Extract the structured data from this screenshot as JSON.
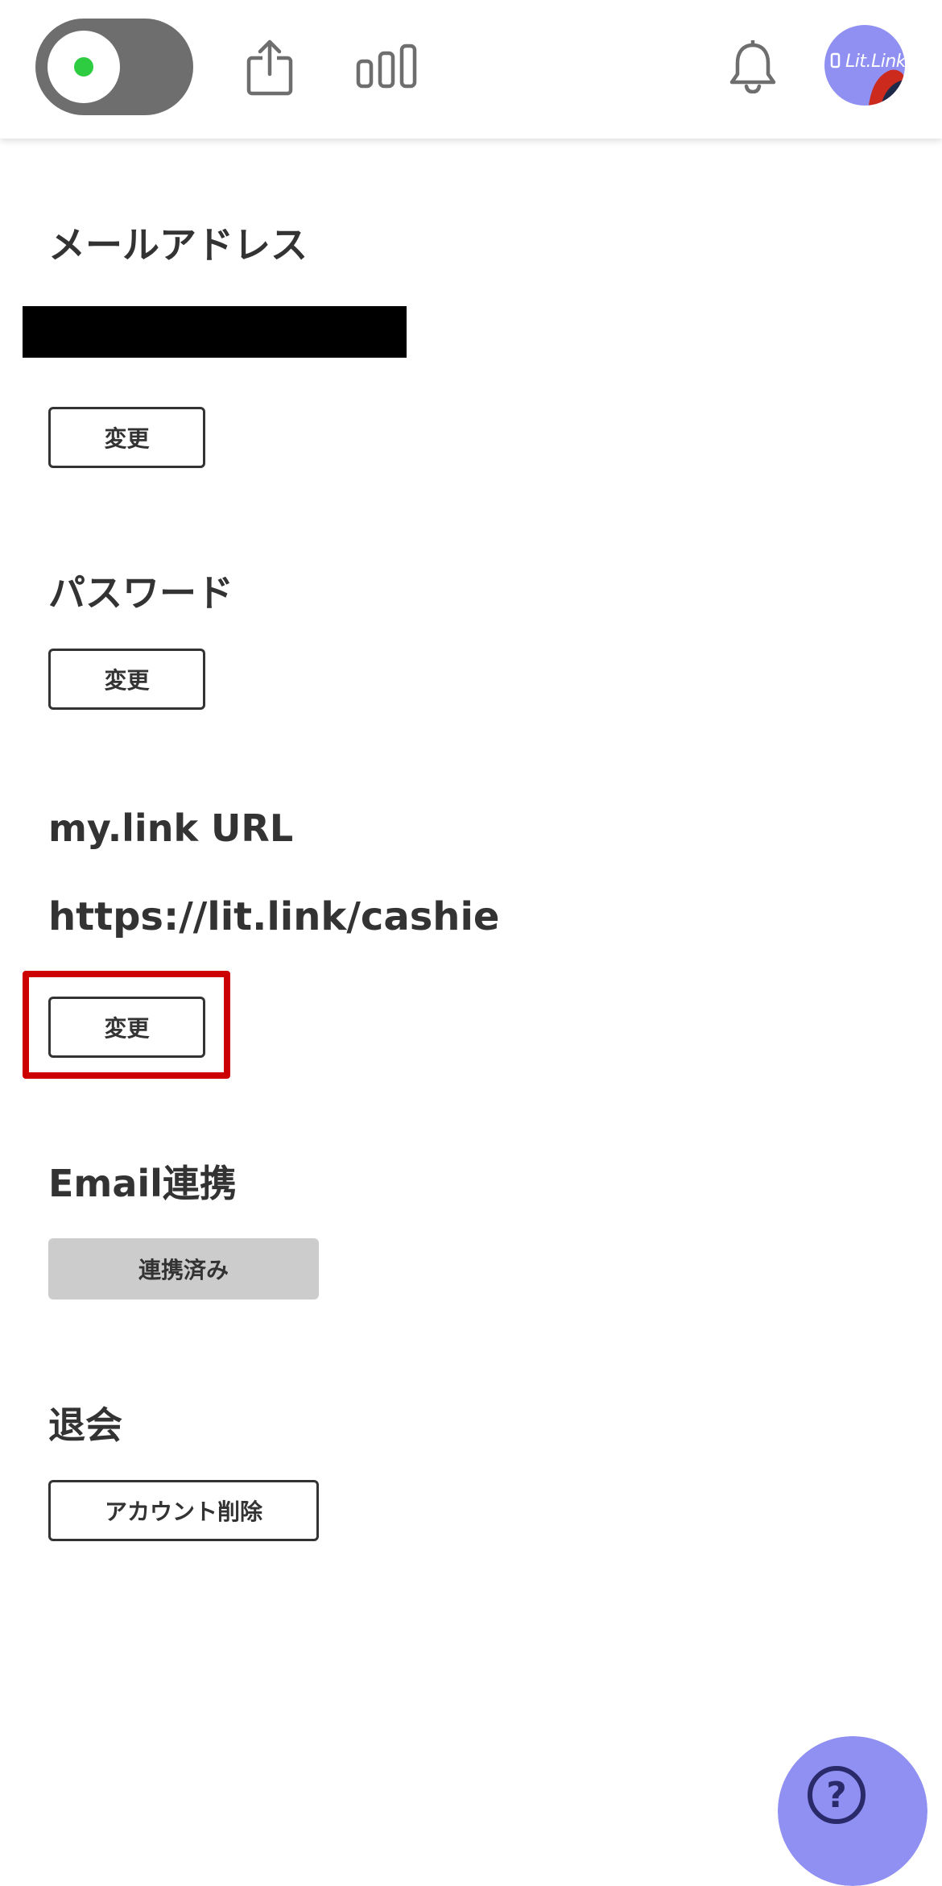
{
  "colors": {
    "toggle_track": "#6e6e6e",
    "toggle_dot": "#2ecc40",
    "accent": "#8f90f2",
    "highlight": "#cc0000",
    "text": "#333333",
    "disabled_button": "#cccccc"
  },
  "header": {
    "toggle": {
      "state": "on",
      "icon": "status-dot"
    },
    "share_icon": "share-icon",
    "stats_icon": "bar-chart-icon",
    "bell_icon": "bell-icon",
    "avatar_text": "Lit.Link"
  },
  "sections": {
    "email": {
      "title": "メールアドレス",
      "button": "変更"
    },
    "password": {
      "title": "パスワード",
      "button": "変更"
    },
    "mylink": {
      "title": "my.link URL",
      "url": "https://lit.link/cashie",
      "button": "変更"
    },
    "email_link": {
      "title": "Email連携",
      "button": "連携済み"
    },
    "withdraw": {
      "title": "退会",
      "button": "アカウント削除"
    }
  },
  "help": {
    "icon": "question-icon",
    "symbol": "?"
  }
}
